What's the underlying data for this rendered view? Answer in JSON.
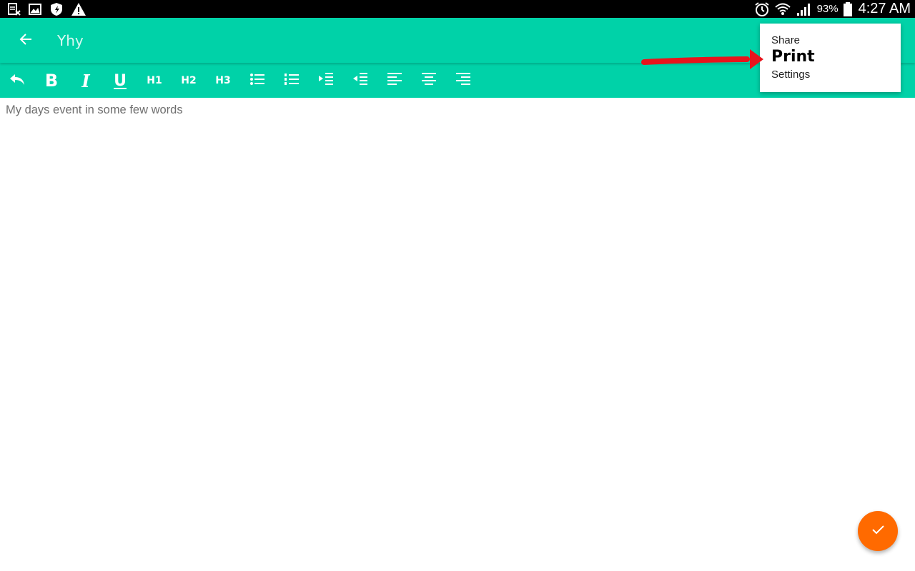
{
  "status_bar": {
    "left_icons": [
      "spreadsheet-x-icon",
      "image-icon",
      "shield-update-icon",
      "warning-icon"
    ],
    "right_icons": [
      "alarm-icon",
      "wifi-icon",
      "signal-icon",
      "battery-icon"
    ],
    "battery_percent": "93%",
    "time": "4:27 AM"
  },
  "app_bar": {
    "title": "Yhy",
    "back_icon": "arrow-back-icon"
  },
  "toolbar": {
    "undo_icon": "undo-icon",
    "bold_label": "B",
    "italic_label": "I",
    "underline_label": "U",
    "h1_label": "H1",
    "h2_label": "H2",
    "h3_label": "H3",
    "bullet_list_icon": "bulleted-list-icon",
    "numbered_list_icon": "numbered-list-icon",
    "indent_icon": "indent-icon",
    "outdent_icon": "outdent-icon",
    "align_left_icon": "align-left-icon",
    "align_center_icon": "align-center-icon",
    "align_right_icon": "align-right-icon"
  },
  "editor": {
    "text": "My days event in some few words"
  },
  "overflow_menu": {
    "items": [
      {
        "label": "Share"
      },
      {
        "label": "Print"
      },
      {
        "label": "Settings"
      }
    ]
  },
  "annotation": {
    "arrow_color": "#e8141c"
  },
  "fab": {
    "icon": "check-icon",
    "color": "#ff6a00"
  },
  "colors": {
    "accent": "#00d2a8",
    "status_bar": "#000000",
    "editor_text": "#6f6f6f"
  }
}
